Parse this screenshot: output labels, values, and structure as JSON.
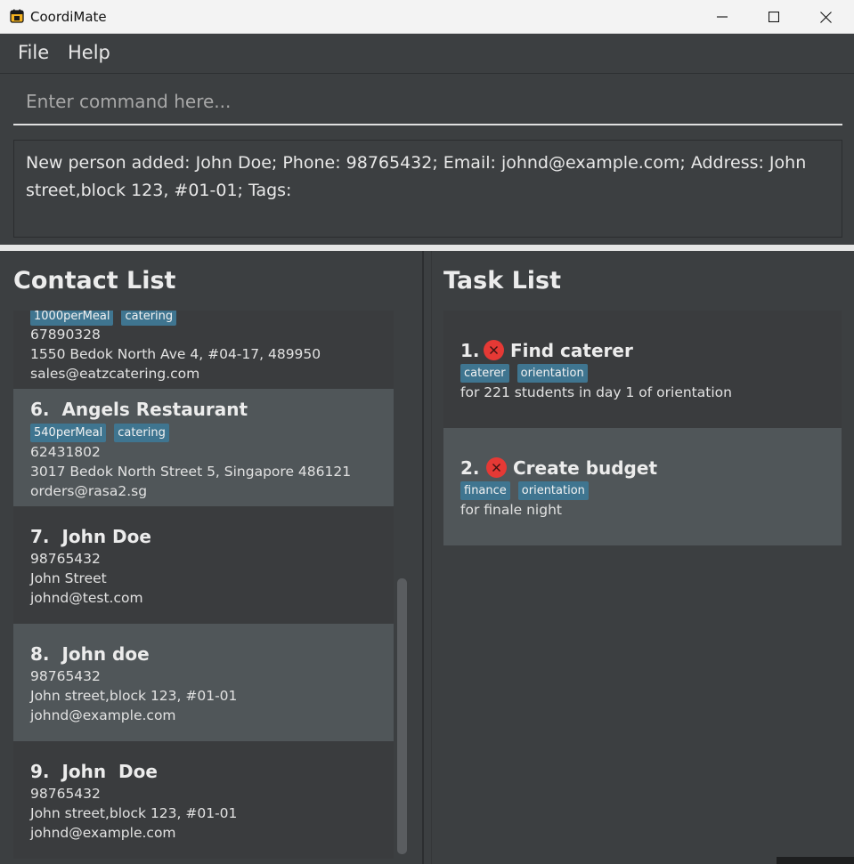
{
  "window": {
    "title": "CoordiMate"
  },
  "menu": [
    "File",
    "Help"
  ],
  "command": {
    "placeholder": "Enter command here..."
  },
  "result": {
    "text": "New person added: John  Doe; Phone: 98765432; Email: johnd@example.com; Address: John street,block 123, #01-01; Tags:"
  },
  "contacts": {
    "title": "Contact List",
    "items": [
      {
        "name": "",
        "tags": [
          "1000perMeal",
          "catering"
        ],
        "phone": "67890328",
        "address": "1550 Bedok North Ave 4, #04-17, 489950",
        "email": "sales@eatzcatering.com"
      },
      {
        "name": "6.  Angels Restaurant",
        "tags": [
          "540perMeal",
          "catering"
        ],
        "phone": "62431802",
        "address": "3017 Bedok North Street 5, Singapore 486121",
        "email": "orders@rasa2.sg"
      },
      {
        "name": "7.  John Doe",
        "tags": [],
        "phone": "98765432",
        "address": "John Street",
        "email": "johnd@test.com"
      },
      {
        "name": "8.  John doe",
        "tags": [],
        "phone": "98765432",
        "address": "John street,block 123, #01-01",
        "email": "johnd@example.com"
      },
      {
        "name": "9.  John  Doe",
        "tags": [],
        "phone": "98765432",
        "address": "John street,block 123, #01-01",
        "email": "johnd@example.com"
      }
    ]
  },
  "tasks": {
    "title": "Task List",
    "items": [
      {
        "num": "1.",
        "title": "Find caterer",
        "tags": [
          "caterer",
          "orientation"
        ],
        "desc": "for 221 students in day 1 of orientation"
      },
      {
        "num": "2.",
        "title": "Create budget",
        "tags": [
          "finance",
          "orientation"
        ],
        "desc": "for finale night"
      }
    ]
  },
  "colors": {
    "tag": "#3f7590",
    "not_done_icon": "#e53935",
    "card_light": "#505659",
    "card_dark": "#3a3c3e"
  },
  "icons": [
    "calendar-app-icon",
    "minimize-icon",
    "maximize-icon",
    "close-icon",
    "not-done-icon"
  ]
}
